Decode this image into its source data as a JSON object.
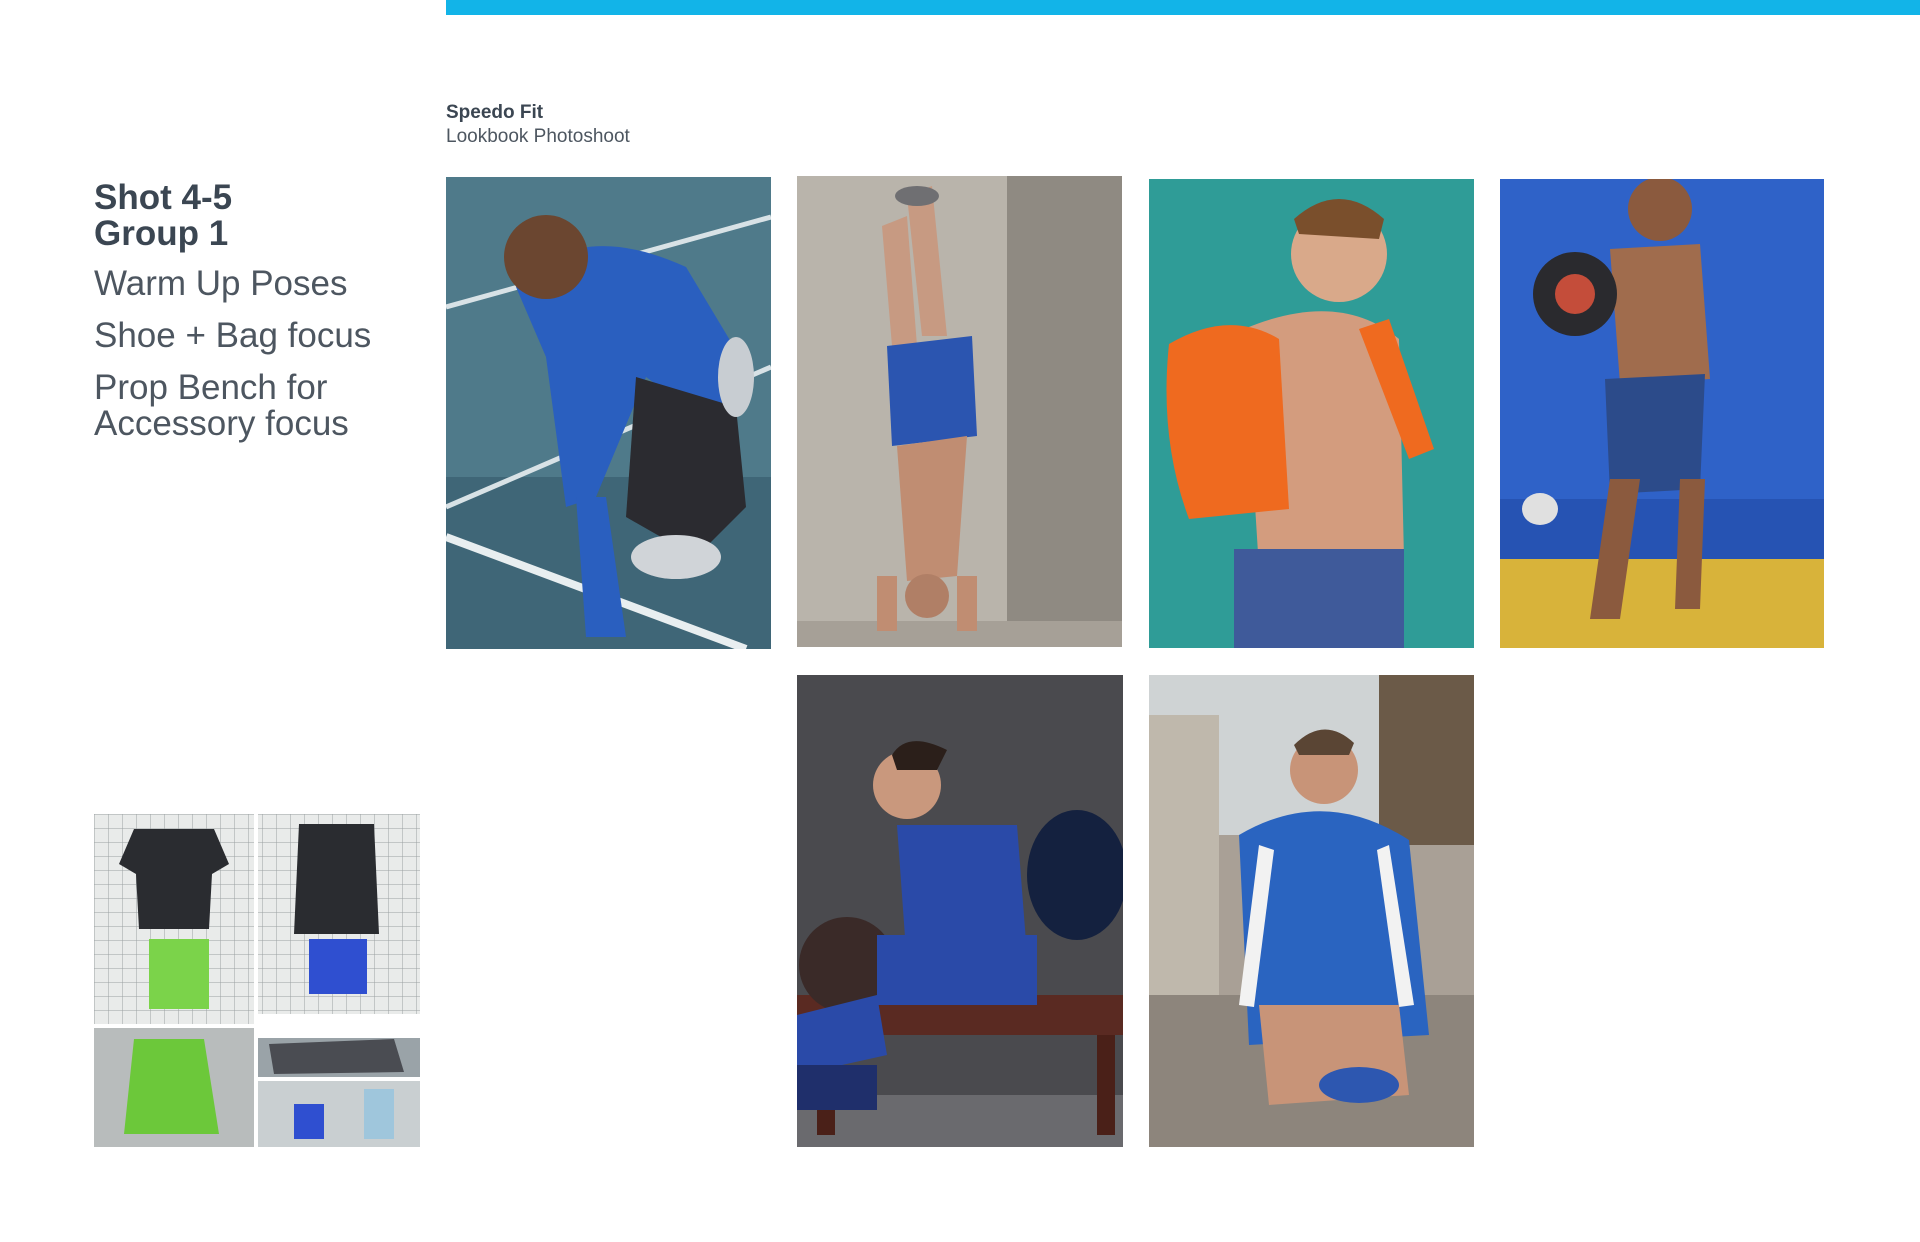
{
  "header": {
    "brand": "Speedo Fit",
    "subtitle": "Lookbook Photoshoot"
  },
  "notes": {
    "shot": "Shot 4-5",
    "group": "Group 1",
    "items": [
      "Warm Up Poses",
      "Shoe + Bag focus",
      "Prop Bench for Accessory focus"
    ]
  },
  "photos": [
    {
      "name": "photo-track-sprinter",
      "subject": "Runner in blue top crouched at start line on blue track"
    },
    {
      "name": "photo-handstand",
      "subject": "Man doing handstand against concrete wall in blue shorts"
    },
    {
      "name": "photo-orange-backpack",
      "subject": "Shirtless model with orange backpack on teal background"
    },
    {
      "name": "photo-medicine-ball",
      "subject": "Shirtless model holding medicine ball on blue and yellow set"
    },
    {
      "name": "photo-bench-sitting",
      "subject": "Model in blue outfit sitting on bench with bag"
    },
    {
      "name": "photo-tying-shoe",
      "subject": "Man in blue striped jacket tying shoe outdoors"
    },
    {
      "name": "photo-product-collage",
      "subject": "Collage of apparel on wire grid and green backpack"
    }
  ],
  "colors": {
    "accent_bar": "#12b4e8",
    "heading": "#3b4652",
    "body_text": "#4d5660"
  }
}
